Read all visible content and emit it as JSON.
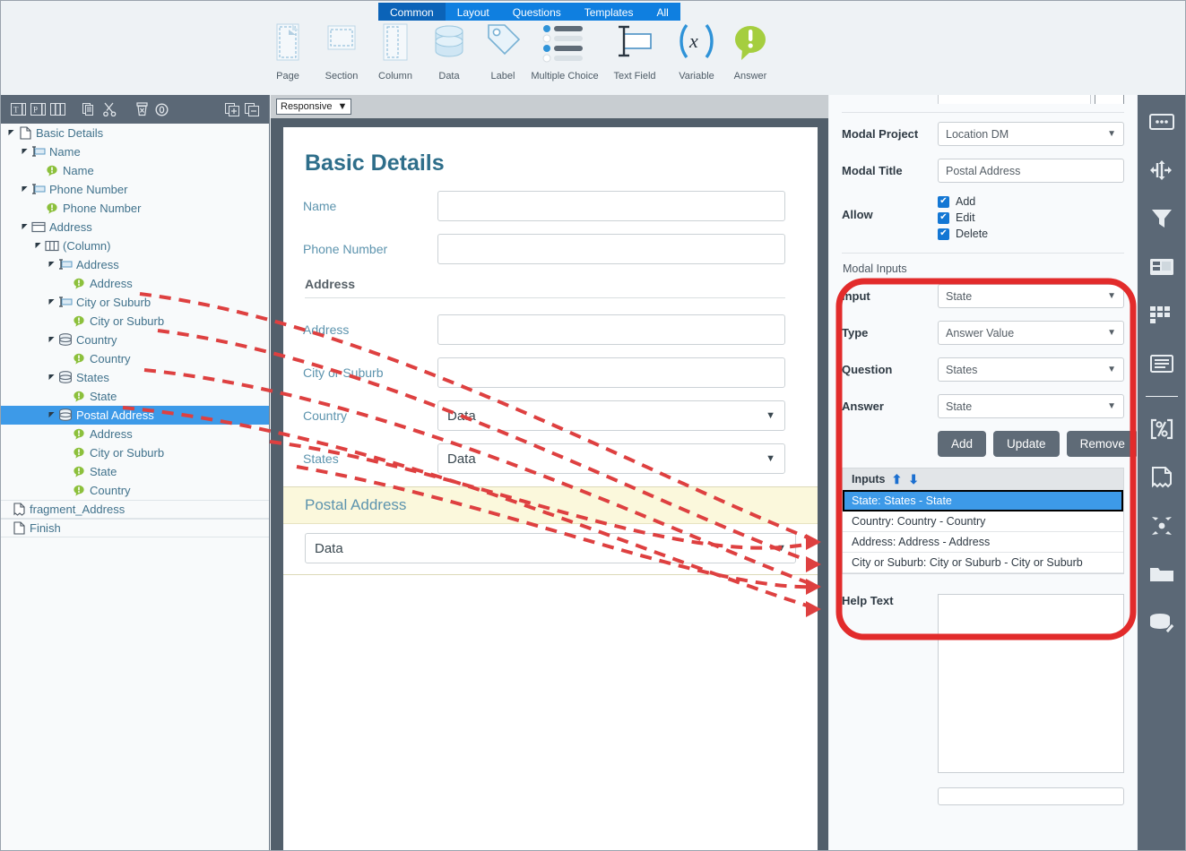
{
  "ribbon": {
    "tabs": [
      {
        "label": "Common",
        "active": true
      },
      {
        "label": "Layout",
        "active": false
      },
      {
        "label": "Questions",
        "active": false
      },
      {
        "label": "Templates",
        "active": false
      },
      {
        "label": "All",
        "active": false
      }
    ],
    "tools": [
      {
        "label": "Page",
        "icon": "page-icon"
      },
      {
        "label": "Section",
        "icon": "section-icon"
      },
      {
        "label": "Column",
        "icon": "column-icon"
      },
      {
        "label": "Data",
        "icon": "data-cylinder-icon"
      },
      {
        "label": "Label",
        "icon": "tag-icon"
      },
      {
        "label": "Multiple Choice",
        "icon": "list-radio-icon"
      },
      {
        "label": "Text Field",
        "icon": "text-field-icon"
      },
      {
        "label": "Variable",
        "icon": "variable-x-icon"
      },
      {
        "label": "Answer",
        "icon": "answer-bubble-icon"
      }
    ]
  },
  "tree_toolbar": {
    "icons": [
      "text-box-icon",
      "paragraph-box-icon",
      "columns-icon",
      "copy-icon",
      "cut-scissors-icon",
      "delete-trash-icon",
      "clear-zero-icon",
      "expand-all-icon",
      "collapse-all-icon"
    ]
  },
  "tree": {
    "nodes": [
      {
        "label": "Basic Details",
        "depth": 0,
        "icon": "page-file-icon",
        "expandable": true,
        "selected": false
      },
      {
        "label": "Name",
        "depth": 1,
        "icon": "textfield-icon",
        "expandable": true,
        "selected": false
      },
      {
        "label": "Name",
        "depth": 2,
        "icon": "answer-icon",
        "expandable": false,
        "selected": false
      },
      {
        "label": "Phone Number",
        "depth": 1,
        "icon": "textfield-icon",
        "expandable": true,
        "selected": false
      },
      {
        "label": "Phone Number",
        "depth": 2,
        "icon": "answer-icon",
        "expandable": false,
        "selected": false
      },
      {
        "label": "Address",
        "depth": 1,
        "icon": "section-icon",
        "expandable": true,
        "selected": false
      },
      {
        "label": "(Column)",
        "depth": 2,
        "icon": "column-icon",
        "expandable": true,
        "selected": false
      },
      {
        "label": "Address",
        "depth": 3,
        "icon": "textfield-icon",
        "expandable": true,
        "selected": false
      },
      {
        "label": "Address",
        "depth": 4,
        "icon": "answer-icon",
        "expandable": false,
        "selected": false
      },
      {
        "label": "City or Suburb",
        "depth": 3,
        "icon": "textfield-icon",
        "expandable": true,
        "selected": false
      },
      {
        "label": "City or Suburb",
        "depth": 4,
        "icon": "answer-icon",
        "expandable": false,
        "selected": false
      },
      {
        "label": "Country",
        "depth": 3,
        "icon": "data-icon",
        "expandable": true,
        "selected": false
      },
      {
        "label": "Country",
        "depth": 4,
        "icon": "answer-icon",
        "expandable": false,
        "selected": false
      },
      {
        "label": "States",
        "depth": 3,
        "icon": "data-icon",
        "expandable": true,
        "selected": false
      },
      {
        "label": "State",
        "depth": 4,
        "icon": "answer-icon",
        "expandable": false,
        "selected": false
      },
      {
        "label": "Postal Address",
        "depth": 3,
        "icon": "data-icon",
        "expandable": true,
        "selected": true
      },
      {
        "label": "Address",
        "depth": 4,
        "icon": "answer-icon",
        "expandable": false,
        "selected": false
      },
      {
        "label": "City or Suburb",
        "depth": 4,
        "icon": "answer-icon",
        "expandable": false,
        "selected": false
      },
      {
        "label": "State",
        "depth": 4,
        "icon": "answer-icon",
        "expandable": false,
        "selected": false
      },
      {
        "label": "Country",
        "depth": 4,
        "icon": "answer-icon",
        "expandable": false,
        "selected": false
      }
    ],
    "files": [
      {
        "label": "fragment_Address",
        "icon": "fragment-file-icon"
      },
      {
        "label": "Finish",
        "icon": "page-file-icon"
      }
    ]
  },
  "canvas": {
    "responsive_select": "Responsive",
    "form_title": "Basic Details",
    "fields": [
      {
        "label": "Name",
        "kind": "text",
        "value": ""
      },
      {
        "label": "Phone Number",
        "kind": "text",
        "value": ""
      }
    ],
    "section_heading": "Address",
    "address_fields": [
      {
        "label": "Address",
        "kind": "text",
        "value": ""
      },
      {
        "label": "City or Suburb",
        "kind": "text",
        "value": ""
      },
      {
        "label": "Country",
        "kind": "select",
        "value": "Data"
      },
      {
        "label": "States",
        "kind": "select",
        "value": "Data"
      }
    ],
    "modal_block": {
      "heading": "Postal Address",
      "select_value": "Data"
    }
  },
  "properties": {
    "modal_project": {
      "label": "Modal Project",
      "value": "Location DM"
    },
    "modal_title": {
      "label": "Modal Title",
      "value": "Postal Address"
    },
    "allow": {
      "label": "Allow",
      "options": [
        {
          "label": "Add",
          "checked": true
        },
        {
          "label": "Edit",
          "checked": true
        },
        {
          "label": "Delete",
          "checked": true
        }
      ]
    },
    "modal_inputs": {
      "section_label": "Modal Inputs",
      "input": {
        "label": "Input",
        "value": "State"
      },
      "type": {
        "label": "Type",
        "value": "Answer Value"
      },
      "question": {
        "label": "Question",
        "value": "States"
      },
      "answer": {
        "label": "Answer",
        "value": "State"
      },
      "buttons": [
        {
          "label": "Add",
          "name": "add-button"
        },
        {
          "label": "Update",
          "name": "update-button"
        },
        {
          "label": "Remove",
          "name": "remove-button"
        }
      ],
      "list_header": "Inputs",
      "move_up_icon": "arrow-up-icon",
      "move_down_icon": "arrow-down-icon",
      "items": [
        {
          "label": "State: States - State",
          "selected": true
        },
        {
          "label": "Country: Country - Country",
          "selected": false
        },
        {
          "label": "Address: Address - Address",
          "selected": false
        },
        {
          "label": "City or Suburb: City or Suburb - City or Suburb",
          "selected": false
        }
      ]
    },
    "help_text": {
      "label": "Help Text",
      "value": ""
    }
  },
  "rail": {
    "icons": [
      "properties-panel-icon",
      "flow-split-icon",
      "filter-funnel-icon",
      "layout-panel-icon",
      "tiles-grid-icon",
      "document-lines-icon",
      "calculation-percent-icon",
      "report-page-icon",
      "distribute-nodes-icon",
      "folder-icon",
      "database-edit-icon"
    ]
  },
  "colors": {
    "accent_blue": "#0f7fe0",
    "selection_blue": "#3d9ae8",
    "annotation_red": "#e03030",
    "panel_gray": "#5b6876",
    "title_teal": "#2e6e8a",
    "highlight_yellow": "#fbf8dc"
  }
}
